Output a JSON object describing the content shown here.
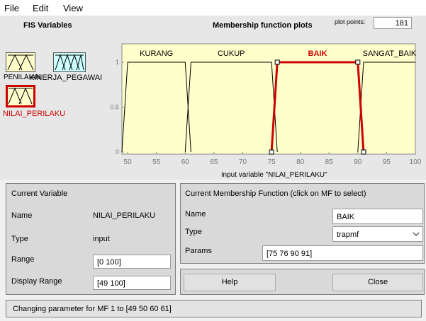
{
  "menu": {
    "file": "File",
    "edit": "Edit",
    "view": "View"
  },
  "fis": {
    "title": "FIS Variables",
    "input1_label": "PENILAIAN",
    "output_label": "KINERJA_PEGAWAI",
    "input2_label": "NILAI_PERILAKU"
  },
  "plot": {
    "title": "Membership function plots",
    "plot_points_label": "plot points:",
    "plot_points_value": "181",
    "xlabel": "input variable \"NILAI_PERILAKU\"",
    "y_ticks": [
      "1",
      "0.5",
      "0"
    ],
    "x_ticks": [
      "50",
      "55",
      "60",
      "65",
      "70",
      "75",
      "80",
      "85",
      "90",
      "95",
      "100"
    ],
    "mf_labels": [
      "KURANG",
      "CUKUP",
      "BAIK",
      "SANGAT_BAIK"
    ]
  },
  "chart_data": {
    "type": "line",
    "xlabel": "input variable \"NILAI_PERILAKU\"",
    "xlim": [
      49,
      100
    ],
    "ylim": [
      0,
      1
    ],
    "series": [
      {
        "name": "KURANG",
        "mf": "trapmf",
        "params": [
          49,
          50,
          60,
          61
        ],
        "color": "#000000"
      },
      {
        "name": "CUKUP",
        "mf": "trapmf",
        "params": [
          60,
          61,
          75,
          76
        ],
        "color": "#000000"
      },
      {
        "name": "BAIK",
        "mf": "trapmf",
        "params": [
          75,
          76,
          90,
          91
        ],
        "color": "#d00000",
        "selected": true
      },
      {
        "name": "SANGAT_BAIK",
        "mf": "trapmf",
        "params": [
          90,
          91,
          100,
          101
        ],
        "color": "#000000"
      }
    ]
  },
  "current_variable": {
    "header": "Current Variable",
    "name_label": "Name",
    "name_value": "NILAI_PERILAKU",
    "type_label": "Type",
    "type_value": "input",
    "range_label": "Range",
    "range_value": "[0 100]",
    "display_range_label": "Display Range",
    "display_range_value": "[49 100]"
  },
  "current_mf": {
    "header": "Current Membership Function (click on MF to select)",
    "name_label": "Name",
    "name_value": "BAIK",
    "type_label": "Type",
    "type_value": "trapmf",
    "params_label": "Params",
    "params_value": "[75 76 90 91]"
  },
  "buttons": {
    "help": "Help",
    "close": "Close"
  },
  "status": "Changing parameter for MF 1 to [49 50 60 61]",
  "colors": {
    "plot_bg": "#ffffcc",
    "selected": "#d00000",
    "output_box": "#ccffff"
  }
}
